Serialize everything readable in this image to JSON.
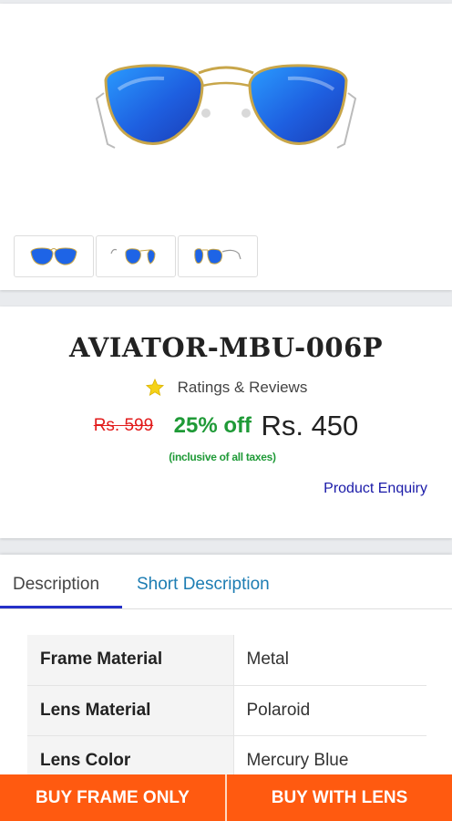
{
  "gallery": {
    "hero_icon": "aviator-sunglasses",
    "thumbnails": [
      "front-view",
      "side-view",
      "angle-view"
    ]
  },
  "product": {
    "name": "AVIATOR-MBU-006P",
    "ratings_label": "Ratings & Reviews",
    "mrp": "Rs. 599",
    "discount": "25% off",
    "price": "Rs. 450",
    "tax_note": "(inclusive of all taxes)",
    "enquiry": "Product Enquiry"
  },
  "tabs": {
    "description": "Description",
    "short_description": "Short Description"
  },
  "specs": [
    {
      "key": "Frame Material",
      "value": "Metal"
    },
    {
      "key": "Lens Material",
      "value": "Polaroid"
    },
    {
      "key": "Lens Color",
      "value": "Mercury Blue"
    }
  ],
  "actions": {
    "buy_frame": "BUY FRAME ONLY",
    "buy_lens": "BUY WITH LENS"
  },
  "colors": {
    "accent": "#ff5a10",
    "discount": "#1f9a37",
    "mrp": "#e21b1b",
    "link": "#1a1aa8",
    "tab_active": "#2530c8",
    "lens": "#1e64e6"
  }
}
